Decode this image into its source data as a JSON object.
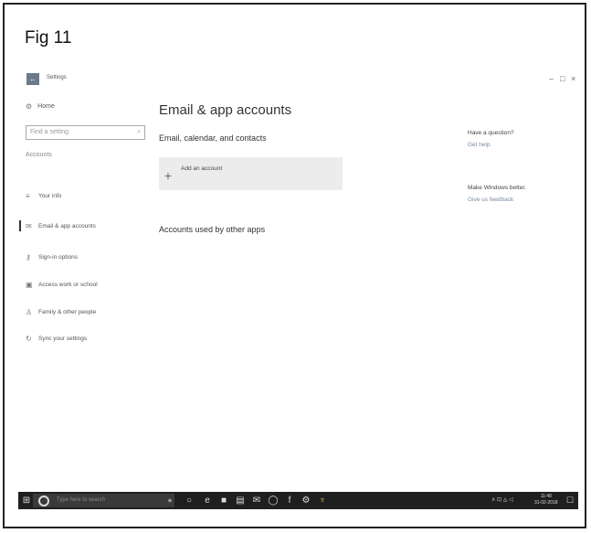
{
  "figure_label": "Fig 11",
  "titlebar": {
    "app_title": "Settings",
    "back_icon": "arrow-left-icon",
    "minimize": "–",
    "maximize": "□",
    "close": "×"
  },
  "nav": {
    "home": "Home",
    "search_placeholder": "Find a setting",
    "section": "Accounts",
    "items": [
      {
        "label": "Your info",
        "icon": "person-card-icon"
      },
      {
        "label": "Email & app accounts",
        "icon": "mail-icon"
      },
      {
        "label": "Sign-in options",
        "icon": "key-icon"
      },
      {
        "label": "Access work or school",
        "icon": "briefcase-icon"
      },
      {
        "label": "Family & other people",
        "icon": "person-icon"
      },
      {
        "label": "Sync your settings",
        "icon": "sync-icon"
      }
    ],
    "selected_index": 1
  },
  "main": {
    "title": "Email & app accounts",
    "subtitle": "Email, calendar, and contacts",
    "add_account": "Add an account",
    "other_apps": "Accounts used by other apps"
  },
  "side": {
    "question": "Have a question?",
    "get_help": "Get help",
    "better": "Make Windows better.",
    "feedback": "Give us feedback"
  },
  "taskbar": {
    "search_placeholder": "Type here to search",
    "clock_time": "11:48",
    "clock_date": "31-02-2018"
  }
}
